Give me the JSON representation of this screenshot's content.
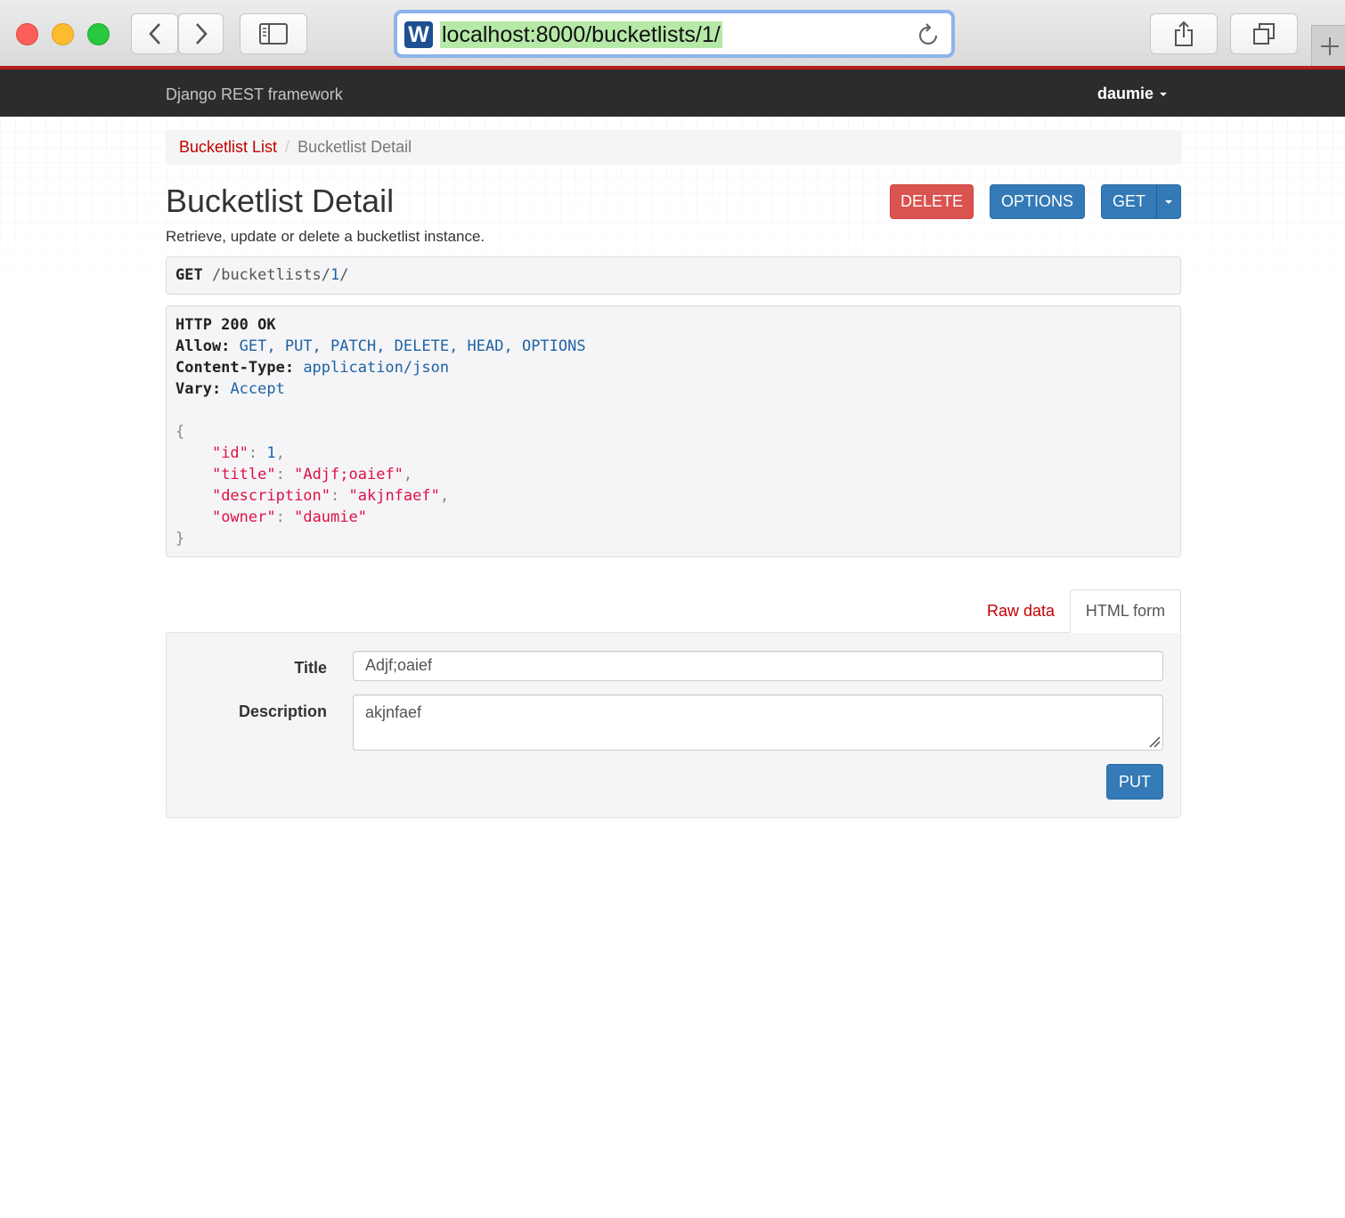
{
  "browser": {
    "url": "localhost:8000/bucketlists/1/",
    "site_icon_letter": "W"
  },
  "navbar": {
    "brand": "Django REST framework",
    "user": "daumie"
  },
  "breadcrumb": {
    "items": [
      "Bucketlist List",
      "Bucketlist Detail"
    ],
    "separator": "/"
  },
  "page": {
    "title": "Bucketlist Detail",
    "description": "Retrieve, update or delete a bucketlist instance."
  },
  "actions": {
    "delete": "DELETE",
    "options": "OPTIONS",
    "get": "GET"
  },
  "request": {
    "method": "GET",
    "path_prefix": "/bucketlists/",
    "path_id": "1",
    "path_suffix": "/"
  },
  "response": {
    "status": "HTTP 200 OK",
    "headers": [
      {
        "name": "Allow:",
        "value": "GET, PUT, PATCH, DELETE, HEAD, OPTIONS"
      },
      {
        "name": "Content-Type:",
        "value": "application/json"
      },
      {
        "name": "Vary:",
        "value": "Accept"
      }
    ],
    "body": {
      "open": "{",
      "close": "}",
      "fields": [
        {
          "key": "\"id\"",
          "value": "1",
          "kind": "number",
          "comma": ","
        },
        {
          "key": "\"title\"",
          "value": "\"Adjf;oaief\"",
          "kind": "string",
          "comma": ","
        },
        {
          "key": "\"description\"",
          "value": "\"akjnfaef\"",
          "kind": "string",
          "comma": ","
        },
        {
          "key": "\"owner\"",
          "value": "\"daumie\"",
          "kind": "string",
          "comma": ""
        }
      ]
    }
  },
  "tabs": {
    "raw": "Raw data",
    "html": "HTML form",
    "active": "HTML form"
  },
  "form": {
    "title_label": "Title",
    "title_value": "Adjf;oaief",
    "description_label": "Description",
    "description_value": "akjnfaef",
    "submit": "PUT"
  },
  "colors": {
    "brand_red": "#c20000",
    "navbar_bg": "#2c2c2c",
    "danger": "#d9534f",
    "primary": "#337ab7"
  }
}
